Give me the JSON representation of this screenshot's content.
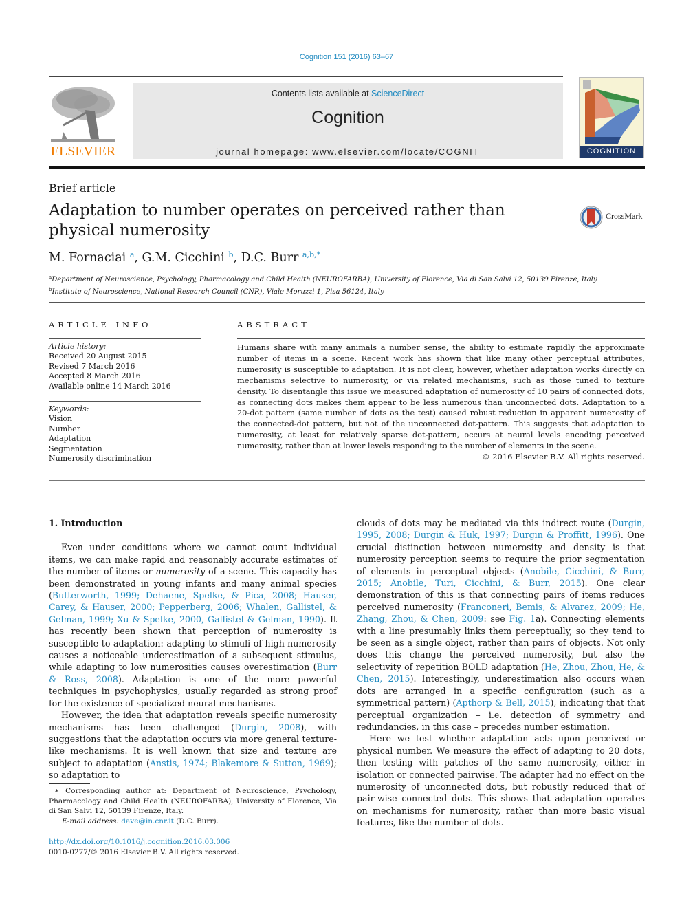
{
  "header": {
    "journal_ref": "Cognition 151 (2016) 63–67",
    "contents_prefix": "Contents lists available at ",
    "contents_link": "ScienceDirect",
    "journal_name": "Cognition",
    "homepage": "journal homepage: www.elsevier.com/locate/COGNIT",
    "publisher_logo_text": "ELSEVIER",
    "cover_label": "COGNITION",
    "colors": {
      "link": "#1f8ac0",
      "elsevier_orange": "#f07c00",
      "banner_bg": "#e8e8e8",
      "cover_band": "#1f3a6a"
    }
  },
  "article": {
    "type": "Brief article",
    "title": "Adaptation to number operates on perceived rather than physical numerosity",
    "crossmark_label": "CrossMark",
    "authors": [
      {
        "name": "M. Fornaciai",
        "sup": "a"
      },
      {
        "name": "G.M. Cicchini",
        "sup": "b"
      },
      {
        "name": "D.C. Burr",
        "sup": "a,b,*"
      }
    ],
    "affiliations": [
      {
        "mark": "a",
        "text": "Department of Neuroscience, Psychology, Pharmacology and Child Health (NEUROFARBA), University of Florence, Via di San Salvi 12, 50139 Firenze, Italy"
      },
      {
        "mark": "b",
        "text": "Institute of Neuroscience, National Research Council (CNR), Viale Moruzzi 1, Pisa 56124, Italy"
      }
    ]
  },
  "article_info": {
    "heading": "ARTICLE INFO",
    "history_label": "Article history:",
    "history": [
      "Received 20 August 2015",
      "Revised 7 March 2016",
      "Accepted 8 March 2016",
      "Available online 14 March 2016"
    ],
    "keywords_label": "Keywords:",
    "keywords": [
      "Vision",
      "Number",
      "Adaptation",
      "Segmentation",
      "Numerosity discrimination"
    ]
  },
  "abstract": {
    "heading": "ABSTRACT",
    "text": "Humans share with many animals a number sense, the ability to estimate rapidly the approximate number of items in a scene. Recent work has shown that like many other perceptual attributes, numerosity is susceptible to adaptation. It is not clear, however, whether adaptation works directly on mechanisms selective to numerosity, or via related mechanisms, such as those tuned to texture density. To disentangle this issue we measured adaptation of numerosity of 10 pairs of connected dots, as connecting dots makes them appear to be less numerous than unconnected dots. Adaptation to a 20-dot pattern (same number of dots as the test) caused robust reduction in apparent numerosity of the connected-dot pattern, but not of the unconnected dot-pattern. This suggests that adaptation to numerosity, at least for relatively sparse dot-pattern, occurs at neural levels encoding perceived numerosity, rather than at lower levels responding to the number of elements in the scene.",
    "copyright": "© 2016 Elsevier B.V. All rights reserved."
  },
  "body": {
    "section_title": "1. Introduction",
    "p1": {
      "a": "Even under conditions where we cannot count individual items, we can make rapid and reasonably accurate estimates of the number of items or ",
      "em": "numerosity",
      "b": " of a scene. This capacity has been demonstrated in young infants and many animal species (",
      "cite1": "Butterworth, 1999; Dehaene, Spelke, & Pica, 2008; Hauser, Carey, & Hauser, 2000; Pepperberg, 2006; Whalen, Gallistel, & Gelman, 1999; Xu & Spelke, 2000, Gallistel & Gelman, 1990",
      "c": "). It has recently been shown that perception of numerosity is susceptible to adaptation: adapting to stimuli of high-numerosity causes a noticeable underestimation of a subsequent stimulus, while adapting to low numerosities causes overestimation (",
      "cite2": "Burr & Ross, 2008",
      "d": "). Adaptation is one of the more powerful techniques in psychophysics, usually regarded as strong proof for the existence of specialized neural mechanisms."
    },
    "p2": {
      "a": "However, the idea that adaptation reveals specific numerosity mechanisms has been challenged (",
      "cite1": "Durgin, 2008",
      "b": "), with suggestions that the adaptation occurs via more general texture-like mechanisms. It is well known that size and texture are subject to adaptation (",
      "cite2": "Anstis, 1974; Blakemore & Sutton, 1969",
      "c": "); so adaptation to clouds of dots may be mediated via this indirect route (",
      "cite3": "Durgin, 1995, 2008; Durgin & Huk, 1997; Durgin & Proffitt, 1996",
      "d": "). One crucial distinction between numerosity and density is that numerosity perception seems to require the prior segmentation of elements in perceptual objects (",
      "cite4": "Anobile, Cicchini, & Burr, 2015; Anobile, Turi, Cicchini, & Burr, 2015",
      "e": "). One clear demonstration of this is that connecting pairs of items reduces perceived numerosity (",
      "cite5": "Franconeri, Bemis, & Alvarez, 2009; He, Zhang, Zhou, & Chen, 2009",
      "f": ": see ",
      "cite6": "Fig. 1",
      "g": "a). Connecting elements with a line presumably links them perceptually, so they tend to be seen as a single object, rather than pairs of objects. Not only does this change the perceived numerosity, but also the selectivity of repetition BOLD adaptation (",
      "cite7": "He, Zhou, Zhou, He, & Chen, 2015",
      "h": "). Interestingly, underestimation also occurs when dots are arranged in a specific configuration (such as a symmetrical pattern) (",
      "cite8": "Apthorp & Bell, 2015",
      "i": "), indicating that that perceptual organization – i.e. detection of symmetry and redundancies, in this case – precedes number estimation."
    },
    "p3": "Here we test whether adaptation acts upon perceived or physical number. We measure the effect of adapting to 20 dots, then testing with patches of the same numerosity, either in isolation or connected pairwise. The adapter had no effect on the numerosity of unconnected dots, but robustly reduced that of pair-wise connected dots. This shows that adaptation operates on mechanisms for numerosity, rather than more basic visual features, like the number of dots."
  },
  "footnote": {
    "star_text": "∗ Corresponding author at: Department of Neuroscience, Psychology, Pharmacology and Child Health (NEUROFARBA), University of Florence, Via di San Salvi 12, 50139 Firenze, Italy.",
    "email_label": "E-mail address: ",
    "email": "dave@in.cnr.it",
    "email_suffix": " (D.C. Burr).",
    "doi": "http://dx.doi.org/10.1016/j.cognition.2016.03.006",
    "issn": "0010-0277/© 2016 Elsevier B.V. All rights reserved."
  }
}
